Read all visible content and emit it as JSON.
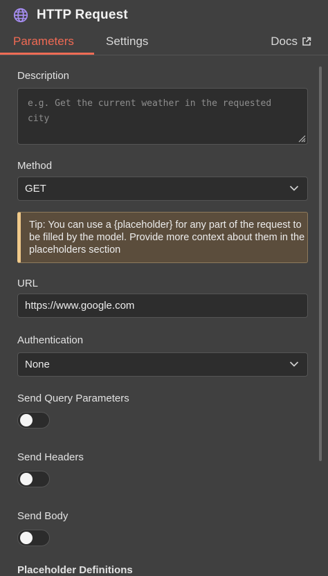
{
  "header": {
    "title": "HTTP Request",
    "icon": "globe-icon",
    "icon_color": "#a58cf0"
  },
  "tabs": [
    {
      "label": "Parameters",
      "active": true
    },
    {
      "label": "Settings",
      "active": false
    }
  ],
  "docs": {
    "label": "Docs",
    "icon": "external-link-icon"
  },
  "description": {
    "label": "Description",
    "placeholder": "e.g. Get the current weather in the requested city"
  },
  "method": {
    "label": "Method",
    "value": "GET"
  },
  "tip": {
    "text": "Tip: You can use a {placeholder} for any part of the request to be filled by the model. Provide more context about them in the placeholders section",
    "accent": "#f0ca8a"
  },
  "url": {
    "label": "URL",
    "value": "https://www.google.com"
  },
  "authentication": {
    "label": "Authentication",
    "value": "None"
  },
  "toggles": [
    {
      "label": "Send Query Parameters",
      "on": false
    },
    {
      "label": "Send Headers",
      "on": false
    },
    {
      "label": "Send Body",
      "on": false
    }
  ],
  "placeholder_section": {
    "label": "Placeholder Definitions"
  },
  "colors": {
    "accent": "#ef6c55",
    "background": "#404040",
    "field": "#2d2d2d"
  }
}
